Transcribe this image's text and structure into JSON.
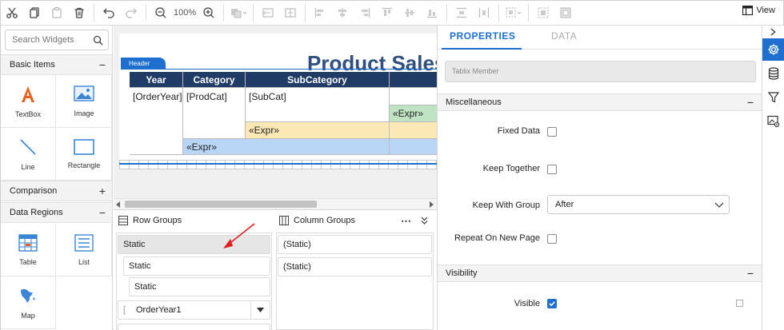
{
  "toolbar": {
    "zoom": "100%",
    "view_label": "View"
  },
  "widgets": {
    "search_placeholder": "Search Widgets",
    "sections": {
      "basic_items": "Basic Items",
      "comparison": "Comparison",
      "data_regions": "Data Regions"
    },
    "basic_items": [
      "TextBox",
      "Image",
      "Line",
      "Rectangle"
    ],
    "data_regions": [
      "Table",
      "List",
      "Map"
    ],
    "collapse_symbol": "−",
    "expand_symbol": "+"
  },
  "canvas": {
    "title": "Product Sales",
    "header_band": "Header",
    "columns": [
      "Year",
      "Category",
      "SubCategory"
    ],
    "cells": {
      "order_year": "[OrderYear]",
      "prod_cat": "[ProdCat]",
      "sub_cat": "[SubCat]",
      "expr_green": "«Expr»",
      "expr_yellow": "«Expr»",
      "expr_blue": "«Expr»"
    }
  },
  "groups": {
    "row_groups_label": "Row Groups",
    "column_groups_label": "Column Groups",
    "row_items": [
      "Static",
      "Static",
      "Static",
      "OrderYear1"
    ],
    "column_items": [
      "(Static)",
      "(Static)"
    ]
  },
  "properties": {
    "tabs": [
      "PROPERTIES",
      "DATA"
    ],
    "tablix_member": "Tablix Member",
    "sections": {
      "misc": "Miscellaneous",
      "visibility": "Visibility"
    },
    "fields": {
      "fixed_data": "Fixed Data",
      "keep_together": "Keep Together",
      "keep_with_group": "Keep With Group",
      "keep_with_group_value": "After",
      "repeat_on_new_page": "Repeat On New Page",
      "visible": "Visible"
    },
    "checked": {
      "fixed_data": false,
      "keep_together": false,
      "repeat_on_new_page": false,
      "visible": true
    }
  },
  "colors": {
    "accent": "#1e6fd0",
    "title": "#2f4f7f",
    "table_header": "#1f3b66",
    "annotation_arrow": "#e02020"
  }
}
